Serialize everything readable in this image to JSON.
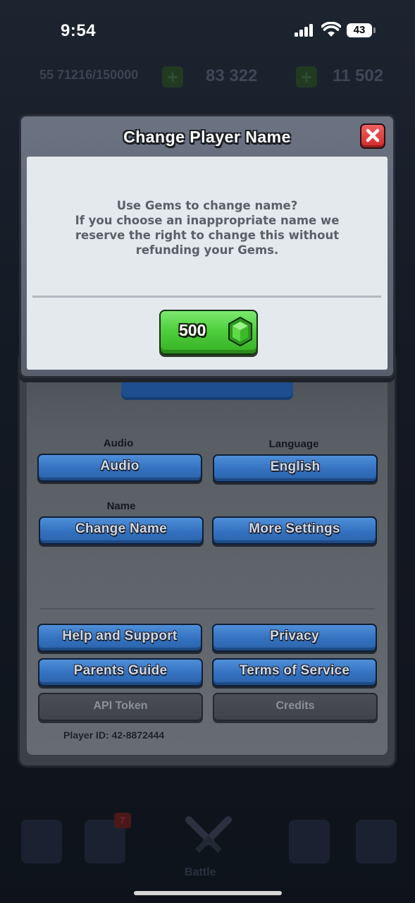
{
  "status_bar": {
    "time": "9:54",
    "battery": "43"
  },
  "game_background": {
    "xp": "55 71216/150000",
    "gold": "83 322",
    "gems": "11 502",
    "nav_badge": "7",
    "battle_label": "Battle"
  },
  "dialog": {
    "title": "Change Player Name",
    "message_line1": "Use Gems to change name?",
    "message_line2": "If you choose an inappropriate name we",
    "message_line3": "reserve the right to change this without",
    "message_line4": "refunding your Gems.",
    "price": "500",
    "icon_close": "close-icon",
    "icon_gem": "gem-icon"
  },
  "settings": {
    "audio_label": "Audio",
    "audio_button": "Audio",
    "language_label": "Language",
    "language_button": "English",
    "name_label": "Name",
    "change_name_button": "Change Name",
    "more_settings_button": "More Settings",
    "help_button": "Help and Support",
    "privacy_button": "Privacy",
    "parents_guide_button": "Parents Guide",
    "terms_button": "Terms of Service",
    "api_token_button": "API Token",
    "credits_button": "Credits",
    "player_id": "Player ID: 42-8872444"
  },
  "colors": {
    "dialog_body": "#e4e9ee",
    "primary_button": "#3371bf",
    "gem_button": "#4fcf3e",
    "close_button": "#d22b2b"
  }
}
